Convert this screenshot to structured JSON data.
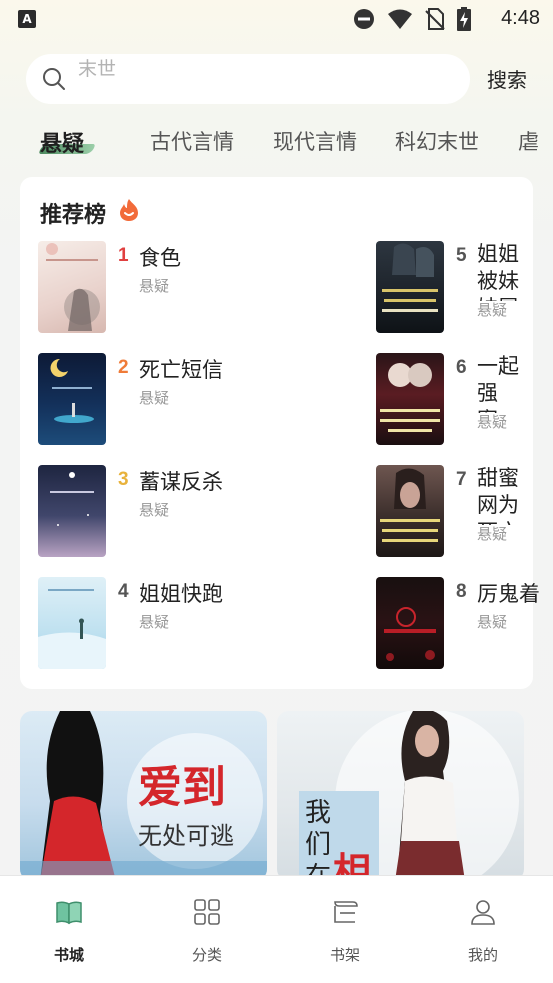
{
  "status_bar": {
    "time": "4:48",
    "app_badge": "A"
  },
  "search": {
    "placeholder": "末世",
    "button_label": "搜索"
  },
  "tabs": [
    {
      "label": "悬疑",
      "active": true
    },
    {
      "label": "古代言情"
    },
    {
      "label": "现代言情"
    },
    {
      "label": "科幻末世"
    },
    {
      "label": "虐"
    }
  ],
  "rank": {
    "title": "推荐榜",
    "books": [
      {
        "rank": "1",
        "title": "食色",
        "category": "悬疑"
      },
      {
        "rank": "2",
        "title": "死亡短信",
        "category": "悬疑"
      },
      {
        "rank": "3",
        "title": "蓄谋反杀",
        "category": "悬疑"
      },
      {
        "rank": "4",
        "title": "姐姐快跑",
        "category": "悬疑"
      },
      {
        "rank": "5",
        "title": "姐姐被妹妹冒充",
        "category": "悬疑"
      },
      {
        "rank": "6",
        "title": "一起强案，隐",
        "category": "悬疑"
      },
      {
        "rank": "7",
        "title": "甜蜜网为死亡",
        "category": "悬疑"
      },
      {
        "rank": "8",
        "title": "厉鬼着",
        "category": "悬疑"
      }
    ],
    "rank_colors": [
      "#e04040",
      "#ef7b38",
      "#e8b23c",
      "#555555"
    ]
  },
  "banners": [
    {
      "line1": "爱到",
      "line2": "无处可逃"
    },
    {
      "text_vertical": "我们在",
      "accent": "相"
    }
  ],
  "bottom_nav": [
    {
      "label": "书城",
      "icon": "book-open-icon",
      "active": true
    },
    {
      "label": "分类",
      "icon": "grid-icon"
    },
    {
      "label": "书架",
      "icon": "bookshelf-icon"
    },
    {
      "label": "我的",
      "icon": "user-icon"
    }
  ],
  "colors": {
    "accent_green": "#4c8a5f",
    "background": "#f3f3f3"
  }
}
